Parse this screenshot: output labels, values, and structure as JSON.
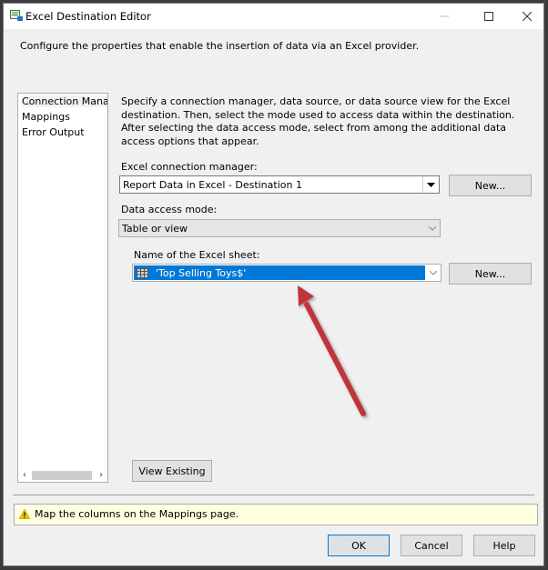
{
  "window": {
    "title": "Excel Destination Editor",
    "controls": {
      "minimize": "minimize",
      "maximize": "maximize",
      "close": "close"
    }
  },
  "header": {
    "description": "Configure the properties that enable the insertion of data via an Excel provider."
  },
  "sidebar": {
    "items": [
      {
        "label": "Connection Manager",
        "selected": true
      },
      {
        "label": "Mappings",
        "selected": false
      },
      {
        "label": "Error Output",
        "selected": false
      }
    ],
    "scroll_left": "‹",
    "scroll_right": "›"
  },
  "main": {
    "description": "Specify a connection manager, data source, or data source view for the Excel destination. Then, select the mode used to access data within the destination. After selecting the data access mode, select from among the additional data access options that appear.",
    "connection_manager": {
      "label": "Excel connection manager:",
      "value": "Report Data in Excel  - Destination 1",
      "new_button": "New..."
    },
    "data_access_mode": {
      "label": "Data access mode:",
      "value": "Table or view"
    },
    "excel_sheet": {
      "label": "Name of the Excel sheet:",
      "value": "'Top Selling Toys$'",
      "new_button": "New..."
    },
    "view_existing_button": "View Existing"
  },
  "status": {
    "icon": "warning-icon",
    "message": "Map the columns on the Mappings page."
  },
  "footer": {
    "ok": "OK",
    "cancel": "Cancel",
    "help": "Help"
  },
  "annotation": {
    "type": "arrow",
    "color": "#c0353a",
    "points_to": "excel-sheet-combo"
  }
}
